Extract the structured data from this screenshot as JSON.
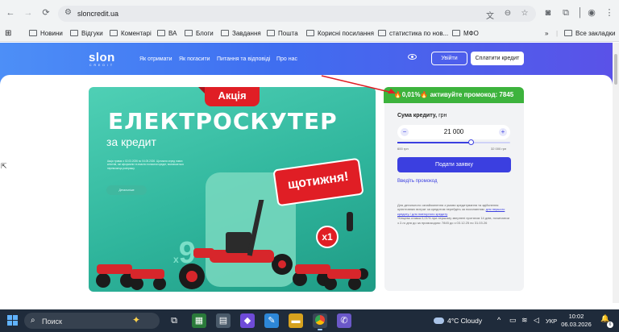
{
  "browser": {
    "url": "sloncredit.ua",
    "bookmarks": [
      "Новини",
      "Відгуки",
      "Коментарі",
      "ВА",
      "Блоги",
      "Завдання",
      "Пошта",
      "Корисні посилання",
      "статистика по нов...",
      "МФО"
    ],
    "all_bookmarks": "Все закладки",
    "more": "»"
  },
  "site": {
    "logo": "slon",
    "logo_sub": "CREDIT",
    "menu": [
      "Як отримати",
      "Як погасити",
      "Питання та відповіді",
      "Про нас"
    ],
    "login": "Увійти",
    "pay": "Сплатити кредит"
  },
  "banner": {
    "badge": "Акція",
    "headline": "ЕЛЕКТРОСКУТЕР",
    "subline": "за кредит",
    "small_text": "Акція триває з 02.03.2026 по 04.05.2026. Щотижня серед нових клієнтів, які оформили та вчасно погасили кредит, визначається переможець розіграшу.",
    "details_button": "Детальніше",
    "multiplier_big": "х",
    "multiplier_num": "9",
    "weekly": "щотижня!",
    "one": "х1"
  },
  "promo": {
    "text": "🔥0,01%🔥 активуйте промокод: 7845"
  },
  "calculator": {
    "label": "Сума кредиту,",
    "unit": "грн",
    "amount": "21 000",
    "minus": "−",
    "plus": "+",
    "min_label": "600 грн",
    "max_label": "32 000 грн",
    "slider_fraction": 0.65,
    "apply": "Подати заявку",
    "promo_link": "Введіть промокод",
    "info_1": "Для детального ознайомлення з умови кредитування та здійснення орієнтовних витрат за кредитом перейдіть за посиланням:",
    "info_link": "для першого кредиту / для повторного кредиту",
    "info_2": "*Кінцева ставка 0,01% при першому звернені протягом 14 днів, починаючи з 2-го дня до за промокодом: 7845 до з 03.12.25 по 31.03.26"
  },
  "taskbar": {
    "search": "Поиск",
    "weather": "4°C  Cloudy",
    "lang": "УКР",
    "time": "10:02",
    "date": "06.03.2026",
    "notifications": "6",
    "tray_up": "^"
  },
  "colors": {
    "accent": "#3b3fe0",
    "promo_green": "#3db33d",
    "banner_red": "#e01e25",
    "banner_teal": "#2fb59c"
  }
}
